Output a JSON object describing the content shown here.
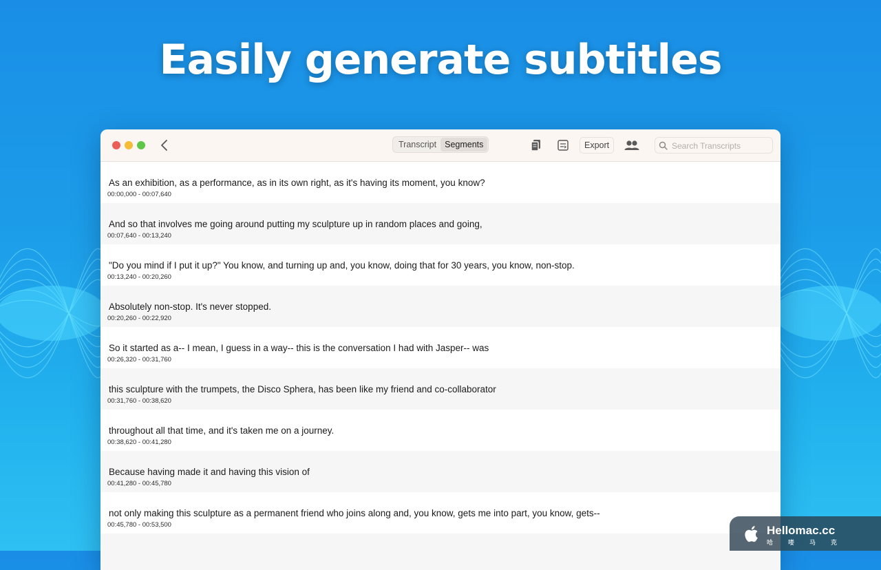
{
  "headline": "Easily generate subtitles",
  "toolbar": {
    "tabs": [
      {
        "label": "Transcript",
        "active": false
      },
      {
        "label": "Segments",
        "active": true
      }
    ],
    "export_label": "Export",
    "search_placeholder": "Search Transcripts",
    "search_value": ""
  },
  "segments": [
    {
      "text": "As an exhibition, as a performance, as in its own right, as it's having its moment, you know?",
      "time": "00:00,000 - 00:07,640"
    },
    {
      "text": "And so that involves me going around putting my sculpture up in random places and going,",
      "time": "00:07,640 - 00:13,240"
    },
    {
      "text": "\"Do you mind if I put it up?\" You know, and turning up and, you know, doing that for 30 years, you know, non-stop.",
      "time": "00:13,240 - 00:20,260"
    },
    {
      "text": "Absolutely non-stop. It's never stopped.",
      "time": "00:20,260 - 00:22,920"
    },
    {
      "text": "So it started as a-- I mean, I guess in a way-- this is the conversation I had with Jasper-- was",
      "time": "00:26,320 - 00:31,760"
    },
    {
      "text": "this sculpture with the trumpets, the Disco Sphera, has been like my friend and co-collaborator",
      "time": "00:31,760 - 00:38,620"
    },
    {
      "text": "throughout all that time, and it's taken me on a journey.",
      "time": "00:38,620 - 00:41,280"
    },
    {
      "text": "Because having made it and having this vision of",
      "time": "00:41,280 - 00:45,780"
    },
    {
      "text": "not only making this sculpture as a permanent friend who joins along and, you know, gets me into part, you know, gets--",
      "time": "00:45,780 - 00:53,500"
    },
    {
      "text": "",
      "time": ""
    }
  ],
  "watermark": {
    "name": "Hellomac.cc",
    "subtitle": "哈喽马克"
  },
  "colors": {
    "background_top": "#1a8ee6",
    "background_bottom": "#2ec0f2",
    "close": "#ec5f57",
    "minimize": "#f4bd35",
    "zoom": "#5fc748"
  }
}
